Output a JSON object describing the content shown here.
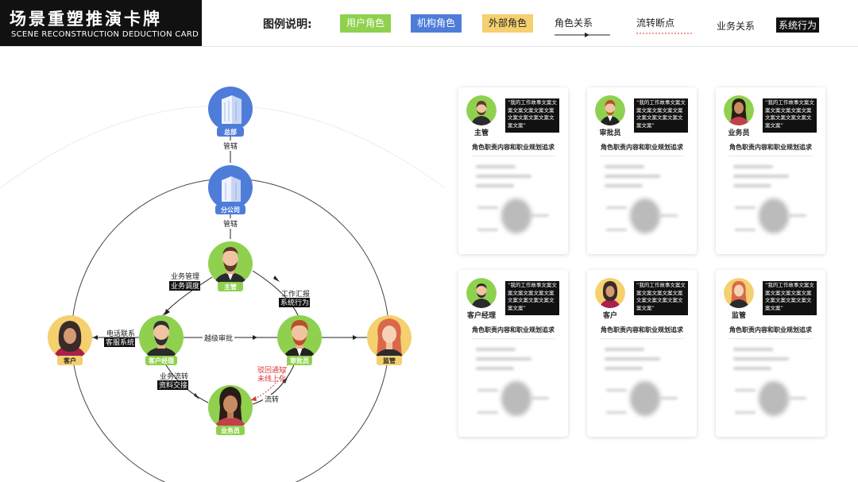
{
  "header": {
    "title_zh": "场景重塑推演卡牌",
    "title_en": "SCENE RECONSTRUCTION DEDUCTION CARD"
  },
  "legend": {
    "label": "图例说明:",
    "user_role": "用户角色",
    "org_role": "机构角色",
    "external_role": "外部角色",
    "role_relation": "角色关系",
    "flow_break": "流转断点",
    "business_relation": "业务关系",
    "system_action": "系统行为"
  },
  "colors": {
    "user": "#8fd14f",
    "org": "#4e7dd9",
    "external": "#f4d06f",
    "break": "#d9373a",
    "dark": "#111111"
  },
  "nodes": {
    "hq": {
      "label": "总部",
      "icon": "building-icon"
    },
    "branch": {
      "label": "分公司",
      "icon": "building-icon"
    },
    "supervisor": {
      "label": "主管"
    },
    "customer": {
      "label": "客户"
    },
    "account_manager": {
      "label": "客户经理"
    },
    "approver": {
      "label": "审批员"
    },
    "regulator": {
      "label": "监管"
    },
    "salesperson": {
      "label": "业务员"
    }
  },
  "edges": {
    "hq_branch": "管辖",
    "branch_supervisor": "管辖",
    "business_mgmt": "业务管理",
    "business_dispatch": "业务调度",
    "work_report": "工作汇报",
    "system_action": "系统行为",
    "phone_contact": "电话联系",
    "service_system": "客服系统",
    "skip_approval": "越级审批",
    "business_flow": "业务流转",
    "material_submit": "资料交接",
    "reject_notice": "驳回通知",
    "not_online": "未线上化",
    "flow": "流转"
  },
  "cards": [
    {
      "role": "主管",
      "quote": "“我的工作故事文案文案文案文案文案文案文案文案文案文案文案文案”",
      "subtitle": "角色职责内容和职业规划追求"
    },
    {
      "role": "审批员",
      "quote": "“我的工作故事文案文案文案文案文案文案文案文案文案文案文案文案”",
      "subtitle": "角色职责内容和职业规划追求"
    },
    {
      "role": "业务员",
      "quote": "“我的工作故事文案文案文案文案文案文案文案文案文案文案文案文案”",
      "subtitle": "角色职责内容和职业规划追求"
    },
    {
      "role": "客户经理",
      "quote": "“我的工作故事文案文案文案文案文案文案文案文案文案文案文案文案”",
      "subtitle": "角色职责内容和职业规划追求"
    },
    {
      "role": "客户",
      "quote": "“我的工作故事文案文案文案文案文案文案文案文案文案文案文案文案”",
      "subtitle": "角色职责内容和职业规划追求"
    },
    {
      "role": "监管",
      "quote": "“我的工作故事文案文案文案文案文案文案文案文案文案文案文案文案”",
      "subtitle": "角色职责内容和职业规划追求"
    }
  ]
}
